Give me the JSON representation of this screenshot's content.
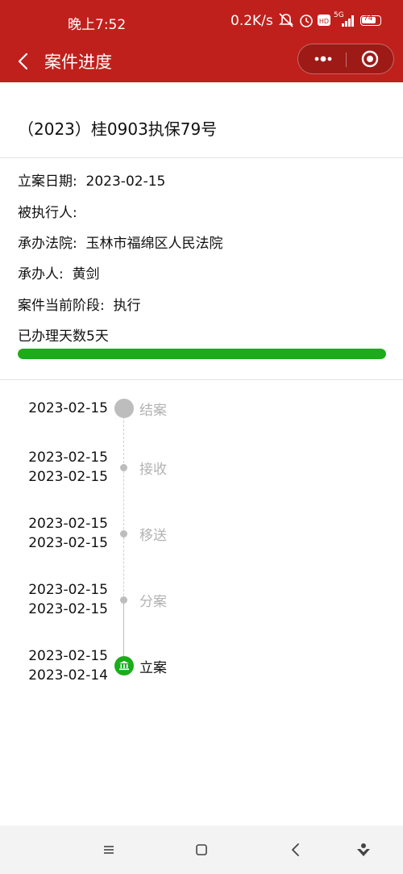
{
  "status_bar": {
    "time": "晚上7:52",
    "network_speed": "0.2K/s",
    "hd_badge": "HD",
    "signal_label": "5G",
    "battery": "74"
  },
  "nav": {
    "title": "案件进度"
  },
  "case": {
    "number": "（2023）桂0903执保79号",
    "filing_date_label": "立案日期:",
    "filing_date": "2023-02-15",
    "respondent_label": "被执行人:",
    "respondent": "",
    "court_label": "承办法院:",
    "court": "玉林市福绵区人民法院",
    "handler_label": "承办人:",
    "handler": "黄剑",
    "stage_label": "案件当前阶段:",
    "stage": "执行",
    "days_text": "已办理天数5天",
    "progress_percent": 100
  },
  "timeline": [
    {
      "dates": [
        "2023-02-15"
      ],
      "label": "结案",
      "state": "pending"
    },
    {
      "dates": [
        "2023-02-15",
        "2023-02-15"
      ],
      "label": "接收",
      "state": "pending"
    },
    {
      "dates": [
        "2023-02-15",
        "2023-02-15"
      ],
      "label": "移送",
      "state": "pending"
    },
    {
      "dates": [
        "2023-02-15",
        "2023-02-15"
      ],
      "label": "分案",
      "state": "pending"
    },
    {
      "dates": [
        "2023-02-15",
        "2023-02-14"
      ],
      "label": "立案",
      "state": "done"
    }
  ],
  "colors": {
    "brand_red": "#c0201c",
    "progress_green": "#1aad19",
    "muted_gray": "#b3b3b3"
  },
  "icons": {
    "back": "chevron-left-icon",
    "more": "more-dots-icon",
    "close": "target-close-icon",
    "done_step": "court-building-icon"
  }
}
